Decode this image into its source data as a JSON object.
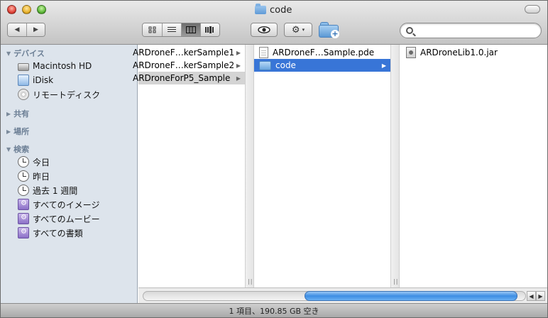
{
  "window": {
    "title": "code",
    "title_icon": "folder-icon"
  },
  "toolbar": {
    "back_label": "◀",
    "forward_label": "▶",
    "views": [
      {
        "name": "icon-view",
        "icon": "grid-icon"
      },
      {
        "name": "list-view",
        "icon": "list-icon"
      },
      {
        "name": "column-view",
        "icon": "columns-icon",
        "active": true
      },
      {
        "name": "coverflow-view",
        "icon": "coverflow-icon"
      }
    ],
    "quicklook_icon": "eye-icon",
    "action_icon": "gear-icon",
    "action_label": "⚙",
    "action_caret": "▾",
    "new_folder_icon": "new-folder-icon",
    "search": {
      "value": "",
      "placeholder": ""
    }
  },
  "sidebar": {
    "sections": [
      {
        "label": "デバイス",
        "expanded": true,
        "items": [
          {
            "label": "Macintosh HD",
            "icon": "hard-drive-icon"
          },
          {
            "label": "iDisk",
            "icon": "idisk-icon"
          },
          {
            "label": "リモートディスク",
            "icon": "remote-disc-icon"
          }
        ]
      },
      {
        "label": "共有",
        "expanded": false,
        "items": []
      },
      {
        "label": "場所",
        "expanded": false,
        "items": []
      },
      {
        "label": "検索",
        "expanded": true,
        "items": [
          {
            "label": "今日",
            "icon": "clock-icon"
          },
          {
            "label": "昨日",
            "icon": "clock-icon"
          },
          {
            "label": "過去 1 週間",
            "icon": "clock-icon"
          },
          {
            "label": "すべてのイメージ",
            "icon": "smart-folder-icon"
          },
          {
            "label": "すべてのムービー",
            "icon": "smart-folder-icon"
          },
          {
            "label": "すべての書類",
            "icon": "smart-folder-icon"
          }
        ]
      }
    ]
  },
  "columns": [
    {
      "items": [
        {
          "label": "ARDroneF…kerSample1",
          "has_children": true,
          "selected": false
        },
        {
          "label": "ARDroneF…kerSample2",
          "has_children": true,
          "selected": false
        },
        {
          "label": "ARDroneForP5_Sample",
          "has_children": true,
          "selected": "inactive"
        }
      ]
    },
    {
      "items": [
        {
          "label": "ARDroneF…Sample.pde",
          "type": "file",
          "icon": "document-icon",
          "has_children": false
        },
        {
          "label": "code",
          "type": "folder",
          "icon": "folder-icon",
          "has_children": true,
          "selected": "active"
        }
      ]
    },
    {
      "items": [
        {
          "label": "ARDroneLib1.0.jar",
          "type": "jar",
          "icon": "jar-icon",
          "has_children": false
        }
      ]
    }
  ],
  "scrollbar": {
    "position_fraction": 0.95,
    "left_arrow": "◀",
    "right_arrow": "▶"
  },
  "status": {
    "text": "1 項目、190.85 GB 空き"
  },
  "colors": {
    "selection_active": "#3875d7",
    "selection_inactive": "#d4d4d4",
    "sidebar_bg": "#dde4ec",
    "sidebar_header": "#6c7f95"
  }
}
